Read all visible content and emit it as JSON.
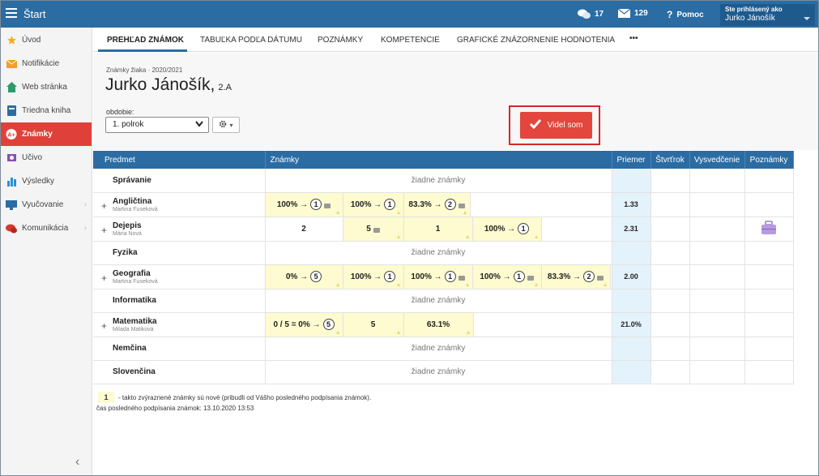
{
  "app": {
    "title": "Štart"
  },
  "topbar": {
    "messages_count": "17",
    "mail_count": "129",
    "help_label": "Pomoc",
    "user_label": "Ste prihlásený ako",
    "user_name": "Jurko Jánošík"
  },
  "sidebar": {
    "items": [
      {
        "label": "Úvod",
        "icon": "star-icon"
      },
      {
        "label": "Notifikácie",
        "icon": "envelope-icon"
      },
      {
        "label": "Web stránka",
        "icon": "home-icon"
      },
      {
        "label": "Triedna kniha",
        "icon": "book-icon"
      },
      {
        "label": "Známky",
        "icon": "grade-icon"
      },
      {
        "label": "Učivo",
        "icon": "lightbulb-icon"
      },
      {
        "label": "Výsledky",
        "icon": "bar-chart-icon"
      },
      {
        "label": "Vyučovanie",
        "icon": "board-icon"
      },
      {
        "label": "Komunikácia",
        "icon": "chat-icon"
      }
    ]
  },
  "tabs": [
    "PREHĽAD ZNÁMOK",
    "TABUĽKA PODĽA DÁTUMU",
    "POZNÁMKY",
    "KOMPETENCIE",
    "GRAFICKÉ ZNÁZORNENIE HODNOTENIA",
    "•••"
  ],
  "header": {
    "subtitle": "Známky žiaka · 2020/2021",
    "student_name": "Jurko Jánošík,",
    "class_name": "2.A",
    "period_label": "obdobie:",
    "period_value": "1. polrok",
    "seen_button": "Videl som"
  },
  "table": {
    "headers": {
      "subject": "Predmet",
      "grades": "Známky",
      "average": "Priemer",
      "quarter": "Štvrťrok",
      "certificate": "Vysvedčenie",
      "notes": "Poznámky"
    },
    "no_grades": "žiadne známky",
    "rows": [
      {
        "subject": "Správanie",
        "teacher": "",
        "average": "",
        "marks": []
      },
      {
        "subject": "Angličtina",
        "teacher": "Martina Fuseková",
        "average": "1.33",
        "marks": [
          {
            "text": "100% →",
            "circle": "1",
            "new": true,
            "note": true
          },
          {
            "text": "100% →",
            "circle": "1",
            "new": true,
            "note": false
          },
          {
            "text": "83.3% →",
            "circle": "2",
            "new": true,
            "note": true
          }
        ]
      },
      {
        "subject": "Dejepis",
        "teacher": "Mária Nová",
        "average": "2.31",
        "has_note_icon": true,
        "marks": [
          {
            "text": "2",
            "circle": "",
            "new": false,
            "note": false
          },
          {
            "text": "5",
            "circle": "",
            "new": true,
            "note": true
          },
          {
            "text": "1",
            "circle": "",
            "new": true,
            "note": false
          },
          {
            "text": "100% →",
            "circle": "1",
            "new": true,
            "note": false
          }
        ]
      },
      {
        "subject": "Fyzika",
        "teacher": "",
        "average": "",
        "marks": []
      },
      {
        "subject": "Geografia",
        "teacher": "Martina Fuseková",
        "average": "2.00",
        "marks": [
          {
            "text": "0% →",
            "circle": "5",
            "new": true,
            "note": false
          },
          {
            "text": "100% →",
            "circle": "1",
            "new": true,
            "note": false
          },
          {
            "text": "100% →",
            "circle": "1",
            "new": true,
            "note": true
          },
          {
            "text": "100% →",
            "circle": "1",
            "new": true,
            "note": true
          },
          {
            "text": "83.3% →",
            "circle": "2",
            "new": true,
            "note": true
          }
        ]
      },
      {
        "subject": "Informatika",
        "teacher": "",
        "average": "",
        "marks": []
      },
      {
        "subject": "Matematika",
        "teacher": "Milada Matiková",
        "average": "21.0%",
        "marks": [
          {
            "text": "0 / 5 = 0% →",
            "circle": "5",
            "new": true,
            "note": false
          },
          {
            "text": "5",
            "circle": "",
            "new": true,
            "note": false
          },
          {
            "text": "63.1%",
            "circle": "",
            "new": true,
            "note": false
          }
        ]
      },
      {
        "subject": "Nemčina",
        "teacher": "",
        "average": "",
        "marks": []
      },
      {
        "subject": "Slovenčina",
        "teacher": "",
        "average": "",
        "marks": []
      }
    ]
  },
  "legend": {
    "sample": "1",
    "text": "- takto zvýraznené známky sú nové (pribudli od Vášho posledného podpísania známok).",
    "sign_time": "čas posledného podpísania známok: 13.10.2020 13:53"
  },
  "colors": {
    "brand": "#2b6ca3",
    "active": "#e0403a",
    "new_mark": "#fdfbcf",
    "average_bg": "#e4f2fb"
  }
}
